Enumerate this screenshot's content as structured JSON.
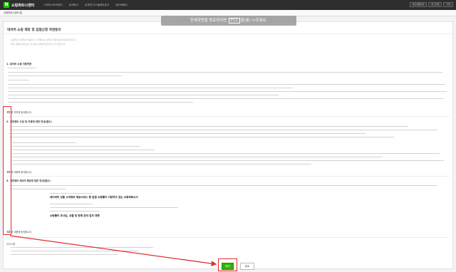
{
  "header": {
    "logo_letter": "N",
    "brand": "쇼핑파트너센터",
    "nav": [
      "스마트스토어센터",
      "검색광고",
      "성과형 디스플레이광고",
      "네이버페이"
    ],
    "right_buttons": [
      "광고상품안내",
      "로그아웃",
      "가입"
    ]
  },
  "breadcrumb": "쇼핑파트너센터 홈",
  "banner": {
    "prefix": "전체화면을 종료하려면",
    "key": "F11",
    "suffix": "을(를) 누르세요."
  },
  "panel": {
    "title": "네이버 쇼핑 제휴 및 입점신청 약관동의",
    "notices": [
      "· 쇼핑파트너센터를 이용하시기 위해서는 아래의 약관에 동의하셔야 합니다.",
      "· 약관 내용을 확인하신 후 동의 여부를 체크해 주시기 바랍니다."
    ],
    "sections": [
      {
        "heading": "1. 네이버 쇼핑 이용약관",
        "agree_label": "위 약관에 동의합니다."
      },
      {
        "heading": "2. 개인정보 수집 및 이용에 대한 안내(필수)",
        "agree_label": "위 내용에 동의합니다."
      },
      {
        "heading": "3. 개인정보 제3자 제공에 대한 안내(필수)",
        "agree_label": "위 내용에 동의합니다."
      }
    ],
    "emphasis": [
      "네이버의 상품 소개정보 제공서비스 등 입점 쇼핑몰이 이용하고 있는 쇼핑파트너서",
      "쇼핑몰의 조사임, 상품 및 판매 관리 업무 대행"
    ],
    "footer_label": "유의사항"
  },
  "buttons": {
    "confirm": "확인",
    "cancel": "취소"
  },
  "colors": {
    "accent_green": "#2db400",
    "highlight_red": "#e03030",
    "topbar": "#2e2e2e"
  }
}
